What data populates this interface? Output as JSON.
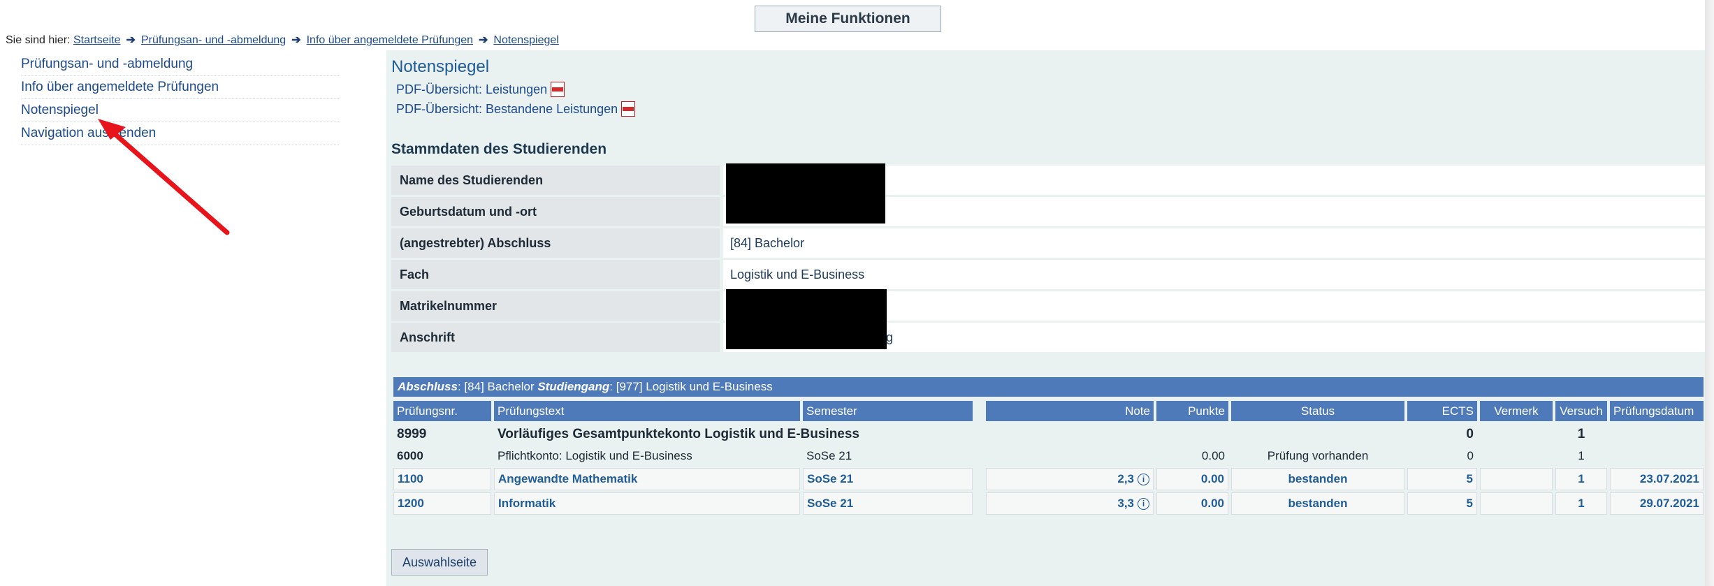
{
  "topbar": {
    "functions_button": "Meine Funktionen"
  },
  "breadcrumb": {
    "prefix": "Sie sind hier:",
    "items": [
      "Startseite",
      "Prüfungsan- und -abmeldung",
      "Info über angemeldete Prüfungen",
      "Notenspiegel"
    ],
    "separator": "➔"
  },
  "sidebar": {
    "items": [
      {
        "label": "Prüfungsan- und -abmeldung"
      },
      {
        "label": "Info über angemeldete Prüfungen"
      },
      {
        "label": "Notenspiegel"
      },
      {
        "label": "Navigation ausblenden"
      }
    ]
  },
  "main": {
    "title": "Notenspiegel",
    "pdf_links": [
      "PDF-Übersicht: Leistungen",
      "PDF-Übersicht: Bestandene Leistungen"
    ],
    "section_title": "Stammdaten des Studierenden",
    "stammdaten": [
      {
        "label": "Name des Studierenden",
        "value": ""
      },
      {
        "label": "Geburtsdatum und -ort",
        "value": ""
      },
      {
        "label": "(angestrebter) Abschluss",
        "value": "[84] Bachelor"
      },
      {
        "label": "Fach",
        "value": "Logistik und E-Business"
      },
      {
        "label": "Matrikelnummer",
        "value": ""
      },
      {
        "label": "Anschrift",
        "value": "g"
      }
    ],
    "results_header": {
      "abschluss_label": "Abschluss",
      "abschluss_value": ": [84] Bachelor ",
      "studiengang_label": "Studiengang",
      "studiengang_value": ": [977] Logistik und E-Business"
    },
    "columns": [
      "Prüfungsnr.",
      "Prüfungstext",
      "Semester",
      "Note",
      "Punkte",
      "Status",
      "ECTS",
      "Vermerk",
      "Versuch",
      "Prüfungsdatum"
    ],
    "rows": [
      {
        "nr": "8999",
        "text": "Vorläufiges Gesamtpunktekonto Logistik und E-Business",
        "semester": "",
        "note": "",
        "punkte": "",
        "status": "",
        "ects": "0",
        "vermerk": "",
        "versuch": "1",
        "datum": ""
      },
      {
        "nr": "6000",
        "text": "Pflichtkonto: Logistik und E-Business",
        "semester": "SoSe 21",
        "note": "",
        "punkte": "0.00",
        "status": "Prüfung vorhanden",
        "ects": "0",
        "vermerk": "",
        "versuch": "1",
        "datum": ""
      },
      {
        "nr": "1100",
        "text": "Angewandte Mathematik",
        "semester": "SoSe 21",
        "note": "2,3",
        "punkte": "0.00",
        "status": "bestanden",
        "ects": "5",
        "vermerk": "",
        "versuch": "1",
        "datum": "23.07.2021"
      },
      {
        "nr": "1200",
        "text": "Informatik",
        "semester": "SoSe 21",
        "note": "3,3",
        "punkte": "0.00",
        "status": "bestanden",
        "ects": "5",
        "vermerk": "",
        "versuch": "1",
        "datum": "29.07.2021"
      }
    ],
    "back_button": "Auswahlseite"
  },
  "colors": {
    "accent": "#4f7ab9",
    "link": "#1c4a8a",
    "annotation_arrow": "#e8141b"
  }
}
